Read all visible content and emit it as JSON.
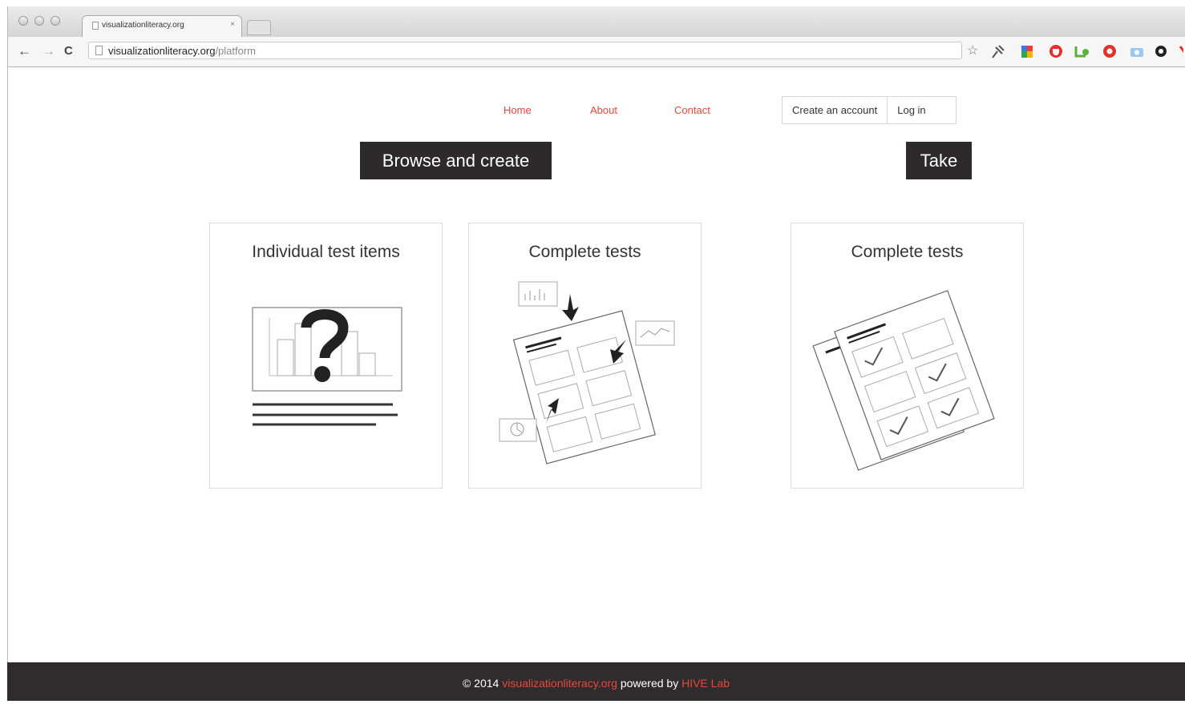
{
  "browser": {
    "tab_title": "visualizationliteracy.org",
    "tab_close": "×",
    "url_host": "visualizationliteracy.org",
    "url_path": "/platform",
    "back_glyph": "←",
    "forward_glyph": "→",
    "reload_glyph": "C",
    "star_glyph": "☆",
    "extension_icons": [
      "pin-icon",
      "google-icon",
      "shield-icon",
      "leaf-icon",
      "lifebuoy-icon",
      "camera-icon",
      "gear-icon",
      "extension-icon"
    ]
  },
  "nav": {
    "home": "Home",
    "about": "About",
    "contact": "Contact",
    "create_account": "Create an account",
    "login": "Log in"
  },
  "sections": {
    "browse": "Browse and create",
    "take": "Take"
  },
  "cards": [
    {
      "title": "Individual test items",
      "icon": "chart-question-icon"
    },
    {
      "title": "Complete tests",
      "icon": "assemble-test-icon"
    },
    {
      "title": "Complete tests",
      "icon": "checked-tests-icon"
    }
  ],
  "footer": {
    "copyright": "© 2014",
    "site": "visualizationliteracy.org",
    "powered": "powered by",
    "lab": "HIVE Lab"
  },
  "colors": {
    "accent": "#e8473b",
    "dark": "#2c2a2b",
    "footer_bg": "#302c2d"
  }
}
